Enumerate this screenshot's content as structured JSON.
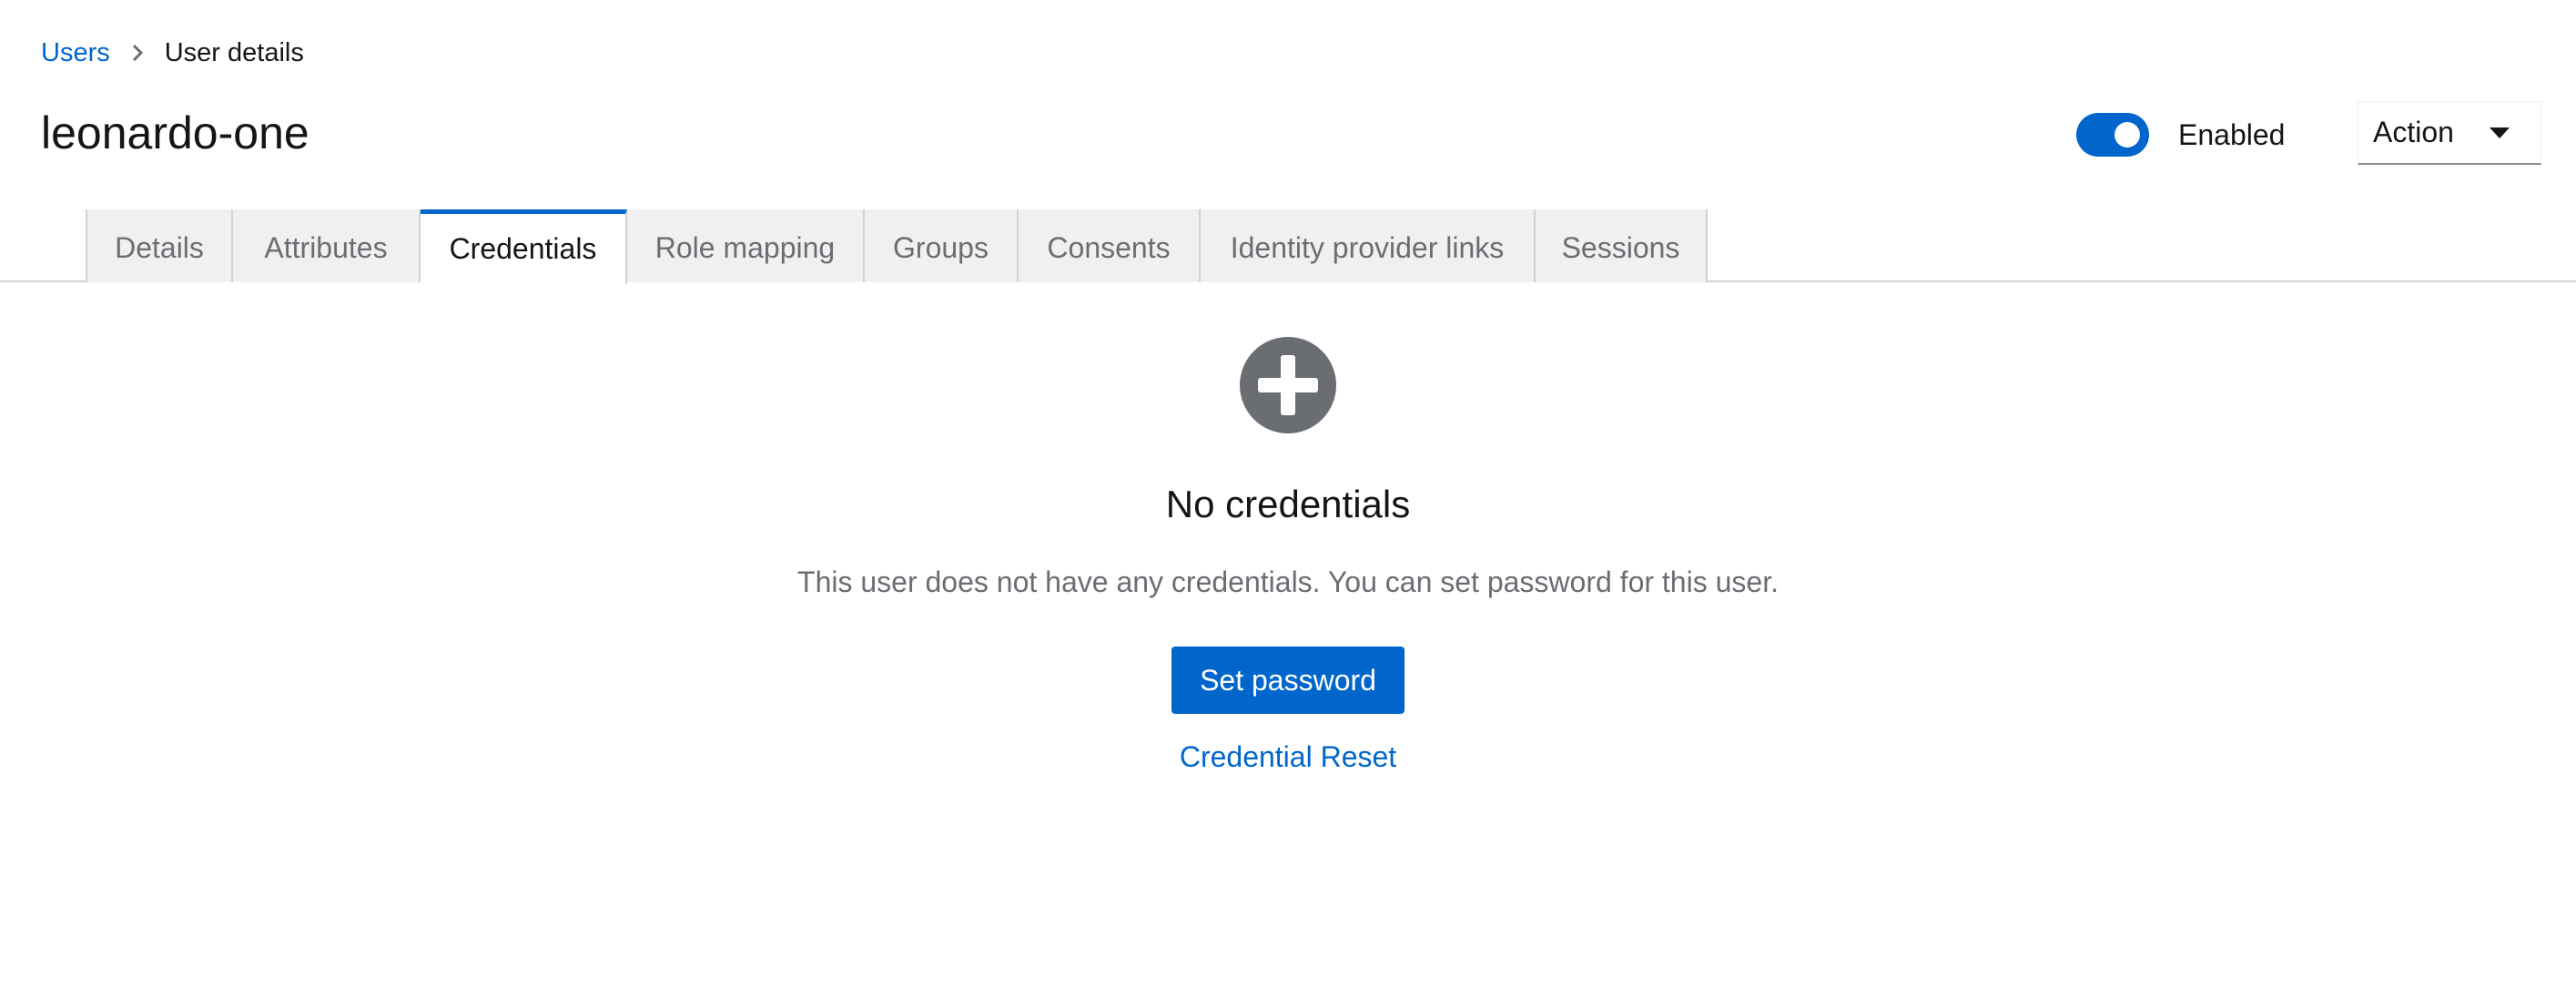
{
  "breadcrumb": {
    "parent": "Users",
    "current": "User details"
  },
  "header": {
    "title": "leonardo-one",
    "enabled_label": "Enabled",
    "enabled": true,
    "action_label": "Action"
  },
  "tabs": [
    {
      "label": "Details",
      "active": false
    },
    {
      "label": "Attributes",
      "active": false
    },
    {
      "label": "Credentials",
      "active": true
    },
    {
      "label": "Role mapping",
      "active": false
    },
    {
      "label": "Groups",
      "active": false
    },
    {
      "label": "Consents",
      "active": false
    },
    {
      "label": "Identity provider links",
      "active": false
    },
    {
      "label": "Sessions",
      "active": false
    }
  ],
  "empty_state": {
    "icon": "plus-circle-icon",
    "title": "No credentials",
    "body": "This user does not have any credentials. You can set password for this user.",
    "primary_button": "Set password",
    "secondary_link": "Credential Reset"
  },
  "colors": {
    "accent": "#0066cc",
    "tab_inactive_bg": "#f0f0f0",
    "muted_text": "#6a6e73",
    "icon_gray": "#6a6e73"
  }
}
